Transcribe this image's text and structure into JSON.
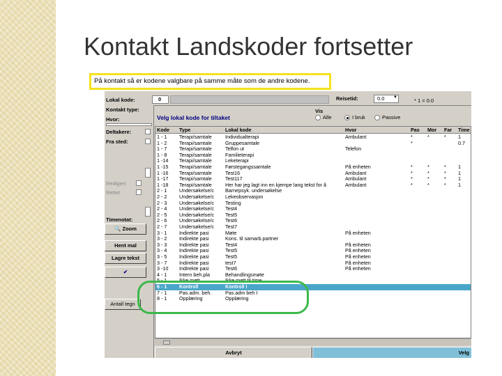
{
  "slide": {
    "title": "Kontakt Landskoder fortsetter",
    "callout": "På kontakt så er kodene valgbare på samme måte som de andre kodene."
  },
  "form": {
    "lokal_kode_label": "Lokal kode:",
    "lokal_kode_value": "0",
    "kontakt_type_label": "Kontakt type:",
    "hvor_label": "Hvor:",
    "deltakere_label": "Deltakere:",
    "fra_sted_label": "Fra sted:",
    "reisetid_label": "Reisetid:",
    "reisetid_value": "0.0",
    "reisetid_note": "* 1 = 0.0",
    "redigert_label": "Redigert",
    "rettet_label": "Rettet",
    "timenotat_label": "Timenotat:",
    "zoom_label": "Zoom",
    "hent_mal_label": "Hent mal",
    "lagre_tekst_label": "Lagre tekst",
    "antall_tegn_label": "Antall tegn"
  },
  "popup": {
    "title": "Velg lokal kode for tiltaket",
    "vis_label": "Vis",
    "radio_alle": "Alle",
    "radio_ibruk": "I bruk",
    "radio_passive": "Passive",
    "selected_radio": "I bruk",
    "columns": [
      "Kode",
      "Type",
      "Lokal kode",
      "Hvor",
      "Pas",
      "Mor",
      "Far",
      "Time"
    ],
    "rows": [
      [
        "1 - 1",
        "Terapi/samtale",
        "Individualterapi",
        "Ambulant",
        "*",
        "*",
        "*",
        "1"
      ],
      [
        "1 - 2",
        "Terapi/samtale",
        "Gruppesamtale",
        "",
        "*",
        "",
        "",
        "0.7"
      ],
      [
        "1 - 7",
        "Terapi/samtale",
        "Telfon ut",
        "Telefon",
        "",
        "",
        "",
        ""
      ],
      [
        "1 - 8",
        "Terapi/samtale",
        "Familieterapi",
        "",
        "",
        "",
        "",
        ""
      ],
      [
        "1 -14",
        "Terapi/samtale",
        "Leketerapi",
        "",
        "",
        "",
        "",
        ""
      ],
      [
        "1 -15",
        "Terapi/samtale",
        "Førstegangssamtale",
        "På enheten",
        "*",
        "*",
        "*",
        "1"
      ],
      [
        "1 -16",
        "Terapi/samtale",
        "Test16",
        "Ambulant",
        "*",
        "*",
        "*",
        "1"
      ],
      [
        "1 -17",
        "Terapi/samtale",
        "Test117",
        "Ambulant",
        "*",
        "*",
        "*",
        "1"
      ],
      [
        "1 -18",
        "Terapi/samtale",
        "Her har jeg lagt inn en kjempe lang tekst for å",
        "Ambulant",
        "*",
        "*",
        "*",
        "1"
      ],
      [
        "2 - 1",
        "Undersøkelse/c",
        "Barnepsyk. undersøkelse",
        "",
        "",
        "",
        "",
        ""
      ],
      [
        "2 - 2",
        "Undersøkelse/c",
        "Lekeobservasjon",
        "",
        "",
        "",
        "",
        ""
      ],
      [
        "2 - 3",
        "Undersøkelse/c",
        "Testing",
        "",
        "",
        "",
        "",
        ""
      ],
      [
        "2 - 4",
        "Undersøkelse/c",
        "Test4",
        "",
        "",
        "",
        "",
        ""
      ],
      [
        "2 - 5",
        "Undersøkelse/c",
        "Test5",
        "",
        "",
        "",
        "",
        ""
      ],
      [
        "2 - 6",
        "Undersøkelse/c",
        "Test6",
        "",
        "",
        "",
        "",
        ""
      ],
      [
        "2 - 7",
        "Undersøkelse/c",
        "Test7",
        "",
        "",
        "",
        "",
        ""
      ],
      [
        "3 - 1",
        "Indirekte pasi",
        "Møte",
        "På enheten",
        "",
        "",
        "",
        ""
      ],
      [
        "3 - 2",
        "Indirekte pasi",
        "Kons. til samarb.partner",
        "",
        "",
        "",
        "",
        ""
      ],
      [
        "3 - 3",
        "Indirekte pasi",
        "Test4",
        "På enheten",
        "",
        "",
        "",
        ""
      ],
      [
        "3 - 4",
        "Indirekte pasi",
        "Test5",
        "På enheten",
        "",
        "",
        "",
        ""
      ],
      [
        "3 - 5",
        "Indirekte pasi",
        "Test5",
        "På enheten",
        "",
        "",
        "",
        ""
      ],
      [
        "3 - 7",
        "Indirekte pasi",
        "test7",
        "På enheten",
        "",
        "",
        "",
        ""
      ],
      [
        "3 -10",
        "Indirekte pasi",
        "Test6",
        "På enheten",
        "",
        "",
        "",
        ""
      ],
      [
        "4 - 1",
        "Intern beh.pla",
        "Behandlingsmøte",
        "",
        "",
        "",
        "",
        ""
      ],
      [
        "5 - 1",
        "Ikke møtt",
        "Ikke møtt til time",
        "",
        "",
        "",
        "",
        ""
      ],
      [
        "6 - 1",
        "Kontroll",
        "Kontroll I",
        "",
        "",
        "",
        "",
        ""
      ],
      [
        "7 - 1",
        "Pas.adm. beh.",
        "Pas.adm beh I",
        "",
        "",
        "",
        "",
        ""
      ],
      [
        "8 - 1",
        "Opplæring",
        "Opplæring",
        "",
        "",
        "",
        "",
        ""
      ]
    ],
    "selected_row_index": 25,
    "cancel_label": "Avbryt",
    "select_label": "Velg"
  }
}
